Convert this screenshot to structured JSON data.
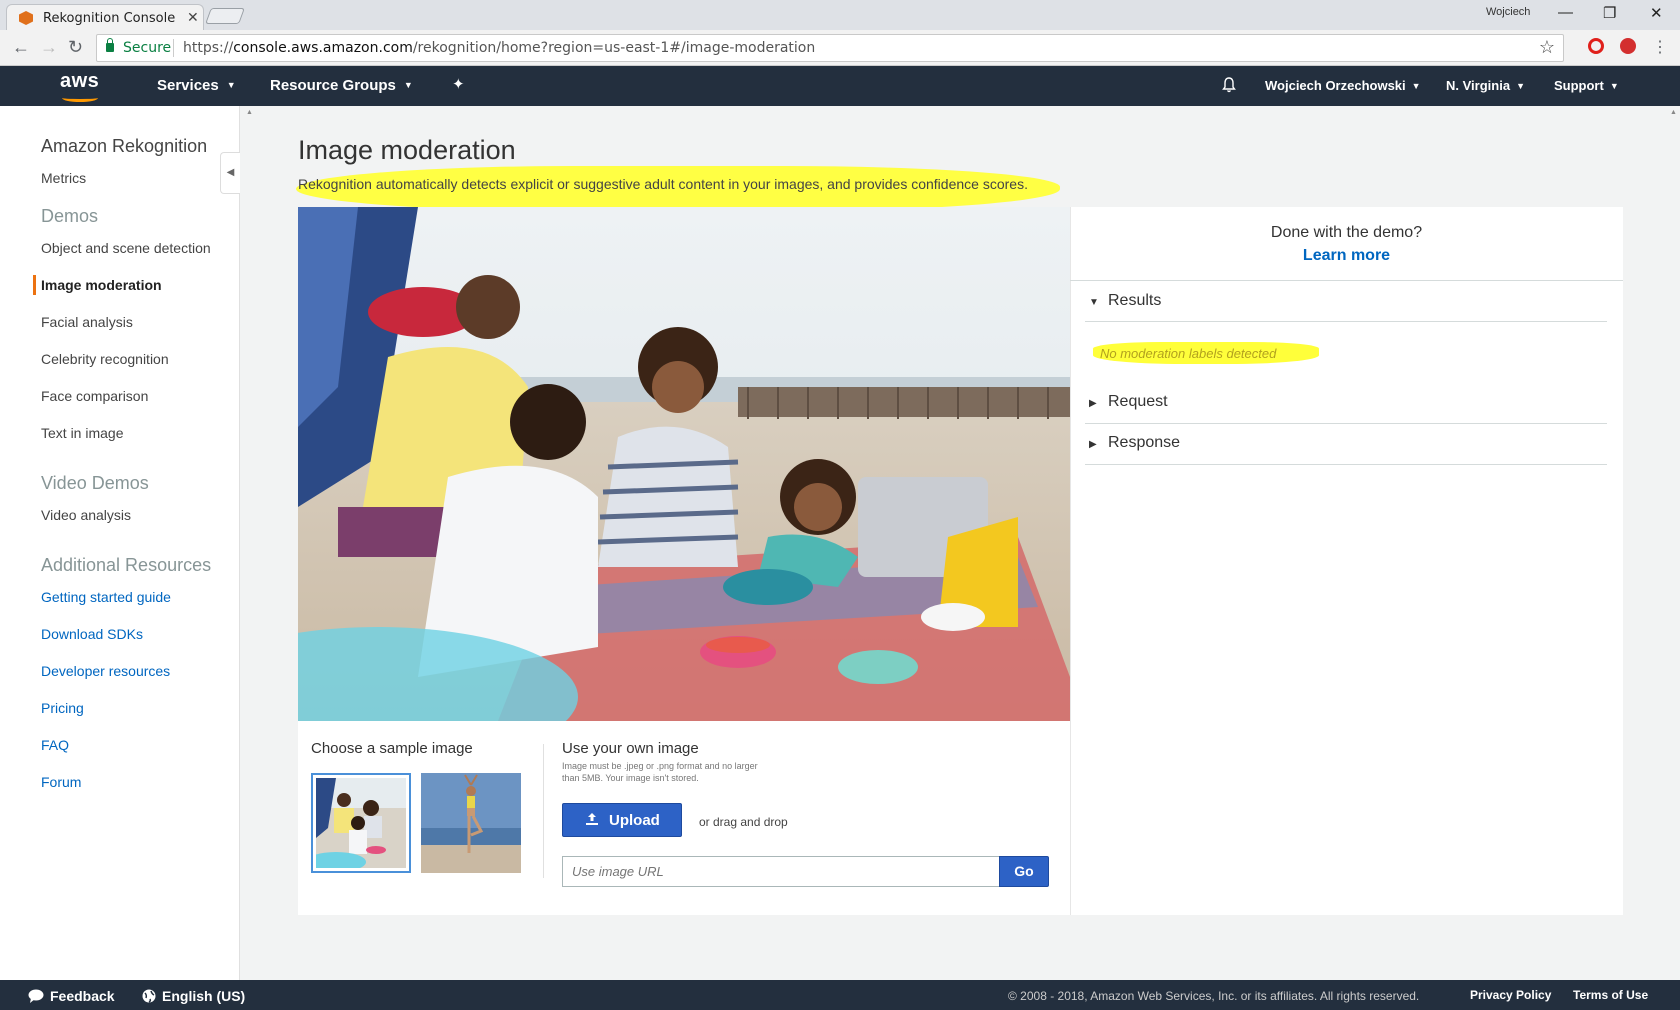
{
  "browser": {
    "tab_title": "Rekognition Console",
    "profile_name": "Wojciech",
    "secure_label": "Secure",
    "url_prefix": "https://",
    "url_host": "console.aws.amazon.com",
    "url_path": "/rekognition/home?region=us-east-1#/image-moderation"
  },
  "topnav": {
    "logo": "aws",
    "services": "Services",
    "resource_groups": "Resource Groups",
    "user": "Wojciech Orzechowski",
    "region": "N. Virginia",
    "support": "Support"
  },
  "sidebar": {
    "title": "Amazon Rekognition",
    "metrics": "Metrics",
    "demos_heading": "Demos",
    "demos": [
      "Object and scene detection",
      "Image moderation",
      "Facial analysis",
      "Celebrity recognition",
      "Face comparison",
      "Text in image"
    ],
    "active_demo": "Image moderation",
    "video_heading": "Video Demos",
    "video_items": [
      "Video analysis"
    ],
    "resources_heading": "Additional Resources",
    "resources": [
      "Getting started guide",
      "Download SDKs",
      "Developer resources",
      "Pricing",
      "FAQ",
      "Forum"
    ]
  },
  "main": {
    "title": "Image moderation",
    "subtitle": "Rekognition automatically detects explicit or suggestive adult content in your images, and provides confidence scores.",
    "done_text": "Done with the demo?",
    "learn_more": "Learn more",
    "results_label": "Results",
    "no_labels": "No moderation labels detected",
    "request_label": "Request",
    "response_label": "Response",
    "choose_sample": "Choose a sample image",
    "own_image": "Use your own image",
    "own_image_note": "Image must be .jpeg or .png format and no larger than 5MB. Your image isn't stored.",
    "upload": "Upload",
    "drag_drop": "or drag and drop",
    "url_placeholder": "Use image URL",
    "go": "Go"
  },
  "footer": {
    "feedback": "Feedback",
    "language": "English (US)",
    "copyright": "© 2008 - 2018, Amazon Web Services, Inc. or its affiliates. All rights reserved.",
    "privacy": "Privacy Policy",
    "terms": "Terms of Use"
  },
  "colors": {
    "nav_bg": "#232f3e",
    "accent_orange": "#ec7211",
    "link_blue": "#0066c0",
    "button_blue": "#2d62c6",
    "highlight_yellow": "#ffff3a"
  }
}
